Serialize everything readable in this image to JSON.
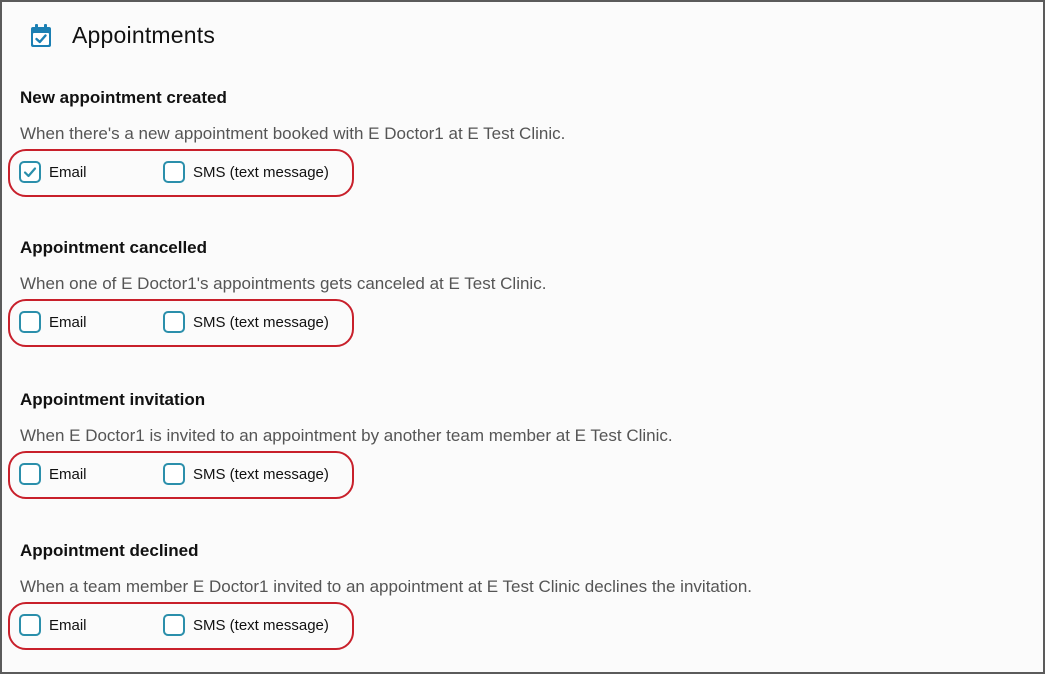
{
  "header": {
    "title": "Appointments",
    "icon": "calendar-check-icon"
  },
  "colors": {
    "accent": "#2b8fab",
    "highlight": "#c8202b",
    "icon": "#1b7fb3"
  },
  "sections": [
    {
      "title": "New appointment created",
      "description": "When there's a new appointment booked with E Doctor1 at E Test Clinic.",
      "email_label": "Email",
      "sms_label": "SMS (text message)",
      "email_checked": true,
      "sms_checked": false
    },
    {
      "title": "Appointment cancelled",
      "description": "When one of E Doctor1's appointments gets canceled at E Test Clinic.",
      "email_label": "Email",
      "sms_label": "SMS (text message)",
      "email_checked": false,
      "sms_checked": false
    },
    {
      "title": "Appointment invitation",
      "description": "When E Doctor1 is invited to an appointment by another team member at E Test Clinic.",
      "email_label": "Email",
      "sms_label": "SMS (text message)",
      "email_checked": false,
      "sms_checked": false
    },
    {
      "title": "Appointment declined",
      "description": "When a team member E Doctor1 invited to an appointment at E Test Clinic declines the invitation.",
      "email_label": "Email",
      "sms_label": "SMS (text message)",
      "email_checked": false,
      "sms_checked": false
    }
  ]
}
